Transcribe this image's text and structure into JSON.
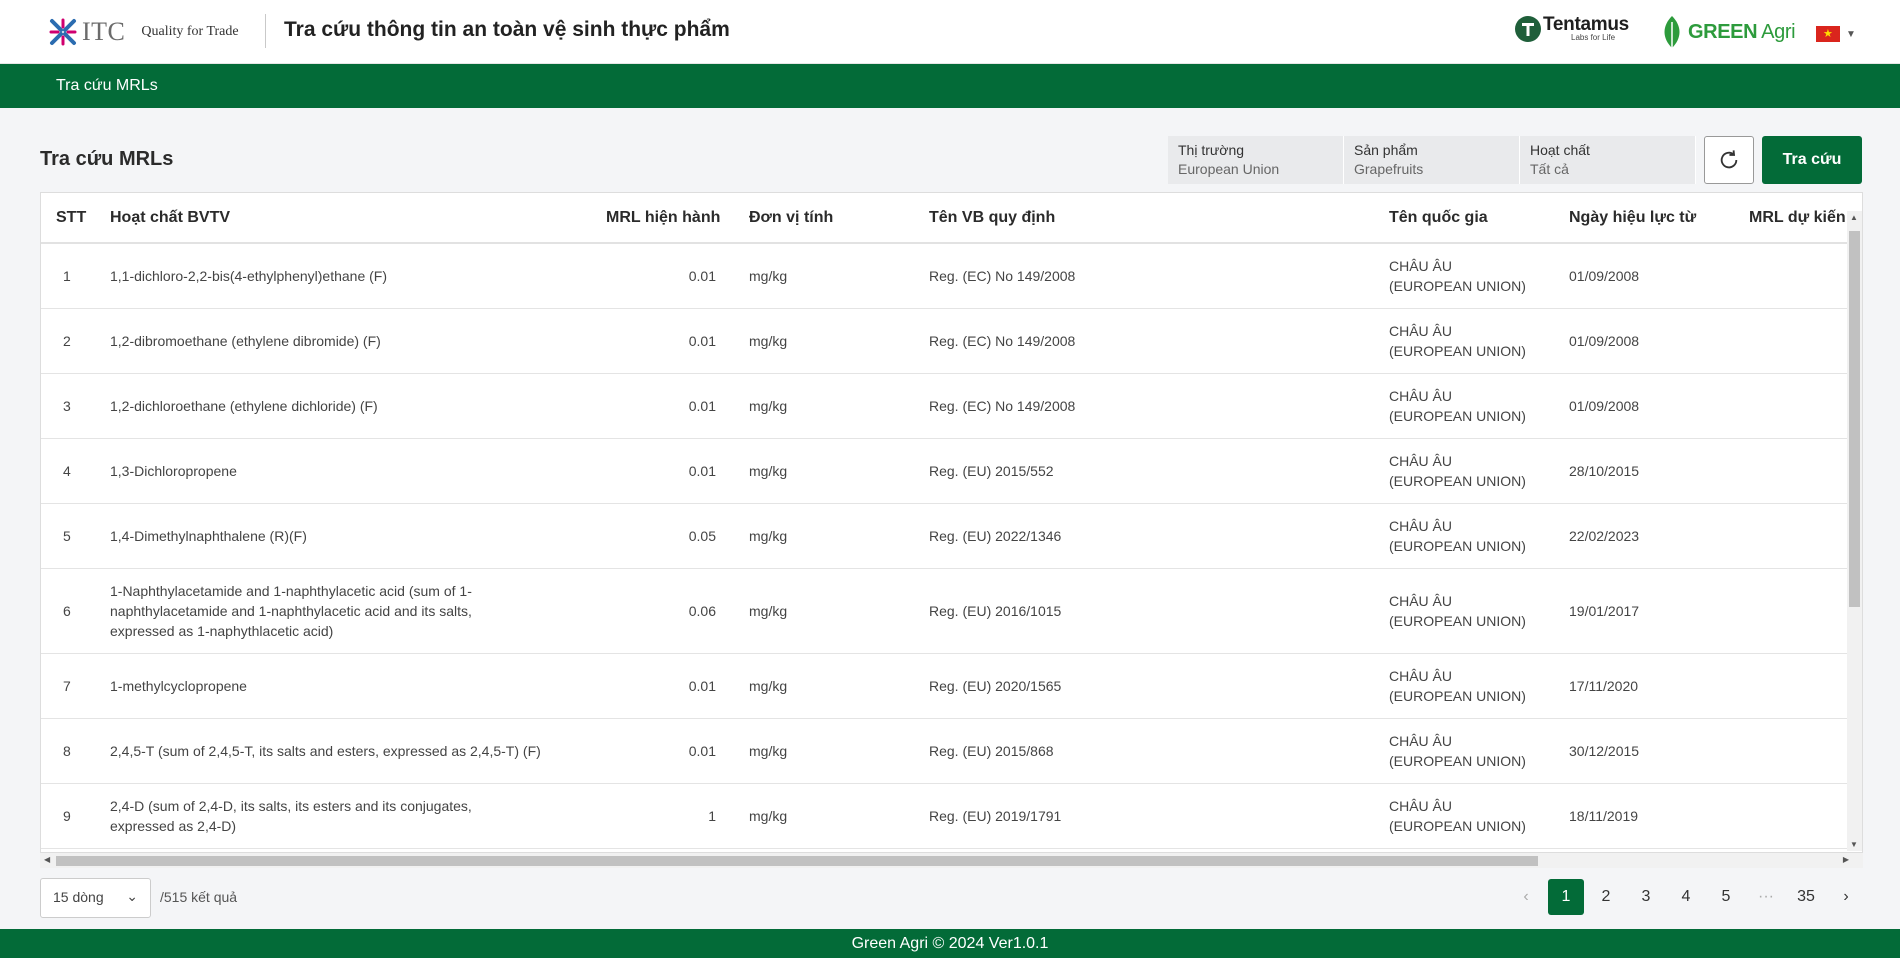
{
  "header": {
    "logo_text": "ITC",
    "tagline": "Quality for Trade",
    "title": "Tra cứu thông tin an toàn vệ sinh thực phẩm",
    "partner1_name": "Tentamus",
    "partner1_sub": "Labs for Life",
    "partner2_name_bold": "GREEN",
    "partner2_name_light": " Agri",
    "language_flag": "vietnam-flag",
    "brand_green": "#036b38"
  },
  "nav": {
    "item": "Tra cứu MRLs"
  },
  "main": {
    "section_title": "Tra cứu MRLs",
    "filters": [
      {
        "label": "Thị trường",
        "value": "European Union"
      },
      {
        "label": "Sản phẩm",
        "value": "Grapefruits"
      },
      {
        "label": "Hoạt chất",
        "value": "Tất cả"
      }
    ],
    "search_label": "Tra cứu"
  },
  "table": {
    "headers": [
      "STT",
      "Hoạt chất BVTV",
      "MRL hiện hành",
      "Đơn vị tính",
      "Tên VB quy định",
      "Tên quốc gia",
      "Ngày hiệu lực từ",
      "MRL dự kiến"
    ],
    "rows": [
      [
        "1",
        "1,1-dichloro-2,2-bis(4-ethylphenyl)ethane (F)",
        "0.01",
        "mg/kg",
        "Reg. (EC) No 149/2008",
        "CHÂU ÂU (EUROPEAN UNION)",
        "01/09/2008"
      ],
      [
        "2",
        "1,2-dibromoethane (ethylene dibromide) (F)",
        "0.01",
        "mg/kg",
        "Reg. (EC) No 149/2008",
        "CHÂU ÂU (EUROPEAN UNION)",
        "01/09/2008"
      ],
      [
        "3",
        "1,2-dichloroethane (ethylene dichloride) (F)",
        "0.01",
        "mg/kg",
        "Reg. (EC) No 149/2008",
        "CHÂU ÂU (EUROPEAN UNION)",
        "01/09/2008"
      ],
      [
        "4",
        "1,3-Dichloropropene",
        "0.01",
        "mg/kg",
        "Reg. (EU) 2015/552",
        "CHÂU ÂU (EUROPEAN UNION)",
        "28/10/2015"
      ],
      [
        "5",
        "1,4-Dimethylnaphthalene (R)(F)",
        "0.05",
        "mg/kg",
        "Reg. (EU) 2022/1346",
        "CHÂU ÂU (EUROPEAN UNION)",
        "22/02/2023"
      ],
      [
        "6",
        "1-Naphthylacetamide and 1-naphthylacetic acid (sum of 1-naphthylacetamide and 1-naphthylacetic acid and its salts, expressed as 1-naphythlacetic acid)",
        "0.06",
        "mg/kg",
        "Reg. (EU) 2016/1015",
        "CHÂU ÂU (EUROPEAN UNION)",
        "19/01/2017"
      ],
      [
        "7",
        "1-methylcyclopropene",
        "0.01",
        "mg/kg",
        "Reg. (EU) 2020/1565",
        "CHÂU ÂU (EUROPEAN UNION)",
        "17/11/2020"
      ],
      [
        "8",
        "2,4,5-T (sum of 2,4,5-T, its salts and esters, expressed as 2,4,5-T) (F)",
        "0.01",
        "mg/kg",
        "Reg. (EU) 2015/868",
        "CHÂU ÂU (EUROPEAN UNION)",
        "30/12/2015"
      ],
      [
        "9",
        "2,4-D (sum of 2,4-D, its salts, its esters and its conjugates, expressed as 2,4-D)",
        "1",
        "mg/kg",
        "Reg. (EU) 2019/1791",
        "CHÂU ÂU (EUROPEAN UNION)",
        "18/11/2019"
      ]
    ]
  },
  "pagination": {
    "rows_per_page": "15 dòng",
    "result_count": "/515 kết quả",
    "pages": [
      "1",
      "2",
      "3",
      "4",
      "5",
      "···",
      "35"
    ],
    "current_page": "1"
  },
  "footer": {
    "text": "Green Agri © 2024 Ver1.0.1"
  }
}
